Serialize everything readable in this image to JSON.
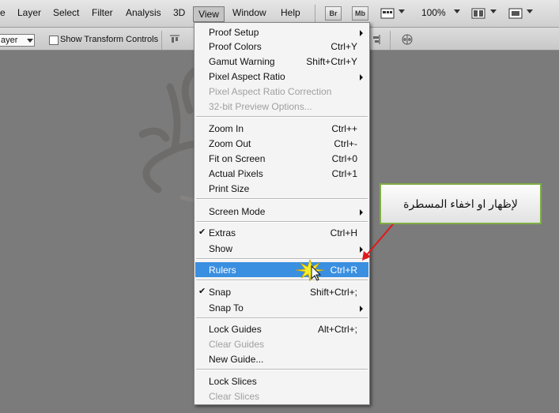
{
  "menubar": {
    "items": [
      {
        "label": "e"
      },
      {
        "label": "Layer"
      },
      {
        "label": "Select"
      },
      {
        "label": "Filter"
      },
      {
        "label": "Analysis"
      },
      {
        "label": "3D"
      },
      {
        "label": "View"
      },
      {
        "label": "Window"
      },
      {
        "label": "Help"
      }
    ],
    "btn_br": "Br",
    "btn_mb": "Mb",
    "zoom": "100%"
  },
  "options": {
    "layer_select": "ayer",
    "show_transform": "Show Transform Controls"
  },
  "menu": {
    "items": [
      {
        "label": "Proof Setup",
        "shortcut": "",
        "submenu": true,
        "disabled": false
      },
      {
        "label": "Proof Colors",
        "shortcut": "Ctrl+Y"
      },
      {
        "label": "Gamut Warning",
        "shortcut": "Shift+Ctrl+Y"
      },
      {
        "label": "Pixel Aspect Ratio",
        "shortcut": "",
        "submenu": true
      },
      {
        "label": "Pixel Aspect Ratio Correction",
        "shortcut": "",
        "disabled": true
      },
      {
        "label": "32-bit Preview Options...",
        "shortcut": "",
        "disabled": true
      },
      {
        "label": "Zoom In",
        "shortcut": "Ctrl++"
      },
      {
        "label": "Zoom Out",
        "shortcut": "Ctrl+-"
      },
      {
        "label": "Fit on Screen",
        "shortcut": "Ctrl+0"
      },
      {
        "label": "Actual Pixels",
        "shortcut": "Ctrl+1"
      },
      {
        "label": "Print Size",
        "shortcut": ""
      },
      {
        "label": "Screen Mode",
        "shortcut": "",
        "submenu": true
      },
      {
        "label": "Extras",
        "shortcut": "Ctrl+H",
        "checked": true
      },
      {
        "label": "Show",
        "shortcut": "",
        "submenu": true
      },
      {
        "label": "Rulers",
        "shortcut": "Ctrl+R",
        "highlighted": true
      },
      {
        "label": "Snap",
        "shortcut": "Shift+Ctrl+;",
        "checked": true
      },
      {
        "label": "Snap To",
        "shortcut": "",
        "submenu": true
      },
      {
        "label": "Lock Guides",
        "shortcut": "Alt+Ctrl+;"
      },
      {
        "label": "Clear Guides",
        "shortcut": "",
        "disabled": true
      },
      {
        "label": "New Guide...",
        "shortcut": ""
      },
      {
        "label": "Lock Slices",
        "shortcut": ""
      },
      {
        "label": "Clear Slices",
        "shortcut": "",
        "disabled": true
      }
    ]
  },
  "callout": {
    "text": "لإظهار او اخفاء المسطرة"
  },
  "colors": {
    "highlight": "#3a8fe0",
    "callout_border": "#7fae43",
    "arrow": "#e0181b"
  }
}
